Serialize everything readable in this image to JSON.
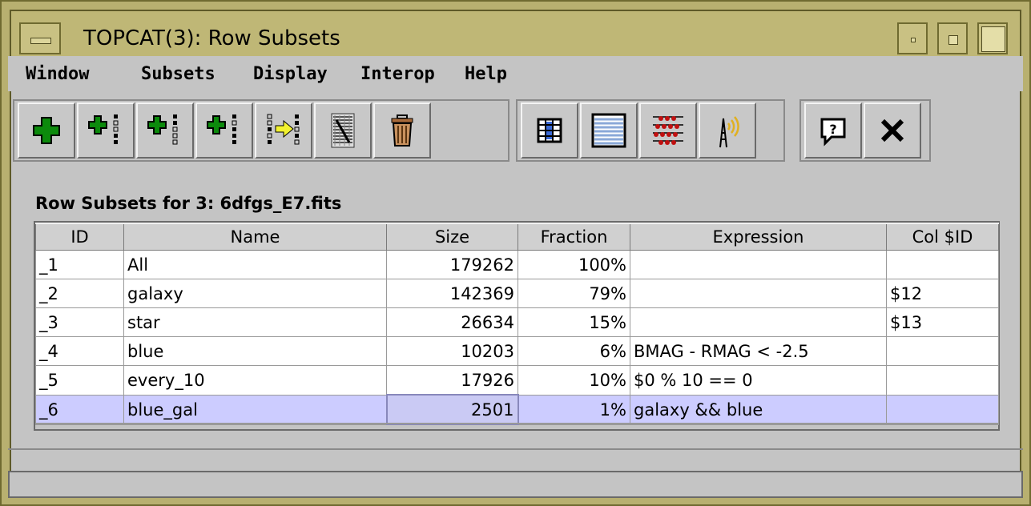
{
  "window": {
    "title": "TOPCAT(3): Row Subsets"
  },
  "menu": [
    "Window",
    "Subsets",
    "Display",
    "Interop",
    "Help"
  ],
  "toolbar": {
    "group1": [
      "add-subset-icon",
      "add-subset-from-column-icon",
      "add-subset-from-expression-icon",
      "add-subset-from-selection-icon",
      "subset-to-column-icon",
      "invert-subset-icon",
      "delete-subset-icon"
    ],
    "group2": [
      "column-view-icon",
      "data-view-icon",
      "statistics-icon",
      "broadcast-icon"
    ],
    "group3": [
      "help-icon",
      "close-icon"
    ]
  },
  "panel_label": "Row Subsets for 3: 6dfgs_E7.fits",
  "table": {
    "columns": [
      "ID",
      "Name",
      "Size",
      "Fraction",
      "Expression",
      "Col $ID"
    ],
    "rows": [
      [
        "_1",
        "All",
        "179262",
        "100%",
        "",
        ""
      ],
      [
        "_2",
        "galaxy",
        "142369",
        "79%",
        "",
        "$12"
      ],
      [
        "_3",
        "star",
        "26634",
        "15%",
        "",
        "$13"
      ],
      [
        "_4",
        "blue",
        "10203",
        "6%",
        "BMAG - RMAG < -2.5",
        ""
      ],
      [
        "_5",
        "every_10",
        "17926",
        "10%",
        "$0 % 10 == 0",
        ""
      ],
      [
        "_6",
        "blue_gal",
        "2501",
        "1%",
        "galaxy && blue",
        ""
      ]
    ],
    "selected_row": 5
  },
  "colors": {
    "title_bar": "#bfb776",
    "selection": "#ccccff"
  }
}
